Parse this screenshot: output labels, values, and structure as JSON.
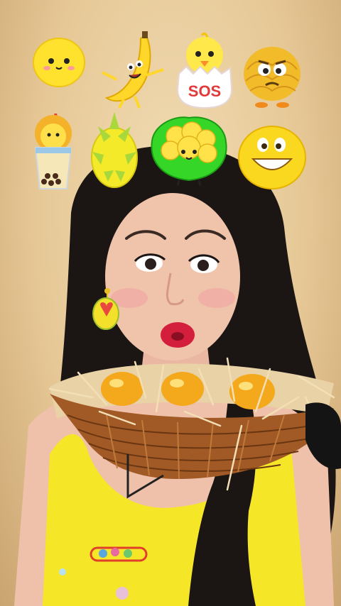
{
  "scene": {
    "sticker_filter_grid": {
      "row1": [
        "lemon-sticker",
        "banana-sticker",
        "chick-in-egg-sticker",
        "noodle-sticker"
      ],
      "row2": [
        "bubble-tea-sticker",
        "dragon-fruit-sticker",
        "cauliflower-sticker",
        "smiley-sticker"
      ],
      "highlighted": "cauliflower-sticker"
    },
    "egg_label": "SOS"
  }
}
